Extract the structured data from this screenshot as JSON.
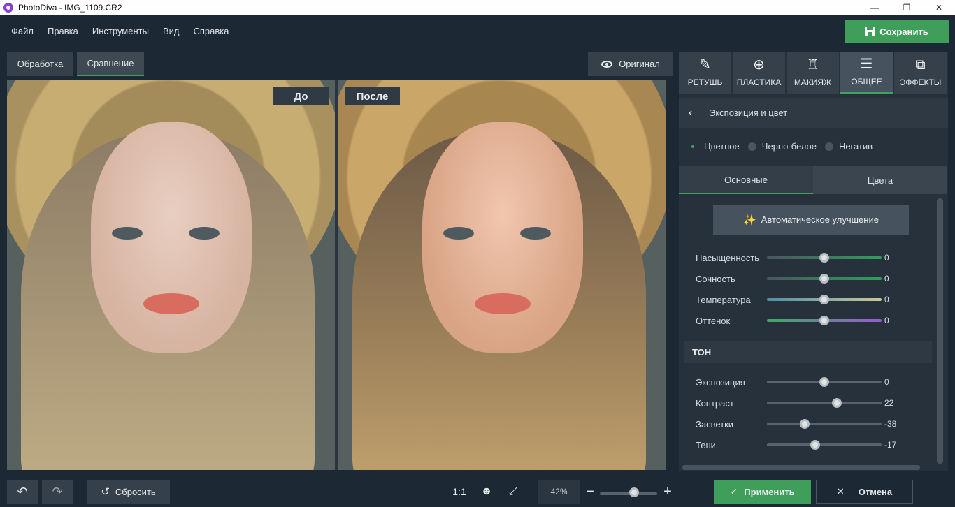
{
  "window": {
    "title": "PhotoDiva - IMG_1109.CR2",
    "minimize": "—",
    "maximize": "❐",
    "close": "✕"
  },
  "menu": {
    "items": [
      "Файл",
      "Правка",
      "Инструменты",
      "Вид",
      "Справка"
    ],
    "save_label": "Сохранить"
  },
  "view_tabs": {
    "processing": "Обработка",
    "compare": "Сравнение",
    "original": "Оригинал"
  },
  "compare": {
    "before_label": "До",
    "after_label": "После"
  },
  "tool_tabs": [
    {
      "label": "РЕТУШЬ",
      "icon": "retouch-brush-icon",
      "glyph": "✎"
    },
    {
      "label": "ПЛАСТИКА",
      "icon": "liquify-icon",
      "glyph": "⊕"
    },
    {
      "label": "МАКИЯЖ",
      "icon": "makeup-icon",
      "glyph": "♖"
    },
    {
      "label": "ОБЩЕЕ",
      "icon": "sliders-icon",
      "glyph": "☰"
    },
    {
      "label": "ЭФФЕКТЫ",
      "icon": "effects-icon",
      "glyph": "⧉"
    }
  ],
  "panel": {
    "section_title": "Экспозиция и цвет",
    "color_modes": [
      "Цветное",
      "Черно-белое",
      "Негатив"
    ],
    "selected_color_mode": "Цветное",
    "sub_tabs": [
      "Основные",
      "Цвета"
    ],
    "auto_enhance": "Автоматическое улучшение",
    "tone_header": "ТОН",
    "color_sliders": [
      {
        "label": "Насыщенность",
        "value": "0",
        "level": 0.5,
        "track": "linear-gradient(90deg,#4a5560,#2f9e5c)"
      },
      {
        "label": "Сочность",
        "value": "0",
        "level": 0.5,
        "track": "linear-gradient(90deg,#4a5560,#2f9e5c)"
      },
      {
        "label": "Температура",
        "value": "0",
        "level": 0.5,
        "track": "linear-gradient(90deg,#4f8fa8,#c8c79a)"
      },
      {
        "label": "Оттенок",
        "value": "0",
        "level": 0.5,
        "track": "linear-gradient(90deg,#3faa64,#9a5ad0)"
      }
    ],
    "tone_sliders": [
      {
        "label": "Экспозиция",
        "value": "0",
        "level": 0.5
      },
      {
        "label": "Контраст",
        "value": "22",
        "level": 0.61
      },
      {
        "label": "Засветки",
        "value": "-38",
        "level": 0.33
      },
      {
        "label": "Тени",
        "value": "-17",
        "level": 0.42
      }
    ]
  },
  "bottom": {
    "undo": "↶",
    "redo": "↷",
    "reset": "Сбросить",
    "ratio": "1:1",
    "zoom": "42%",
    "zoom_level": 0.6,
    "zoom_minus": "−",
    "zoom_plus": "+",
    "apply": "Применить",
    "cancel": "Отмена"
  },
  "colors": {
    "accent_green": "#3f9e5a",
    "background": "#1c2833",
    "panel": "#26313b"
  }
}
